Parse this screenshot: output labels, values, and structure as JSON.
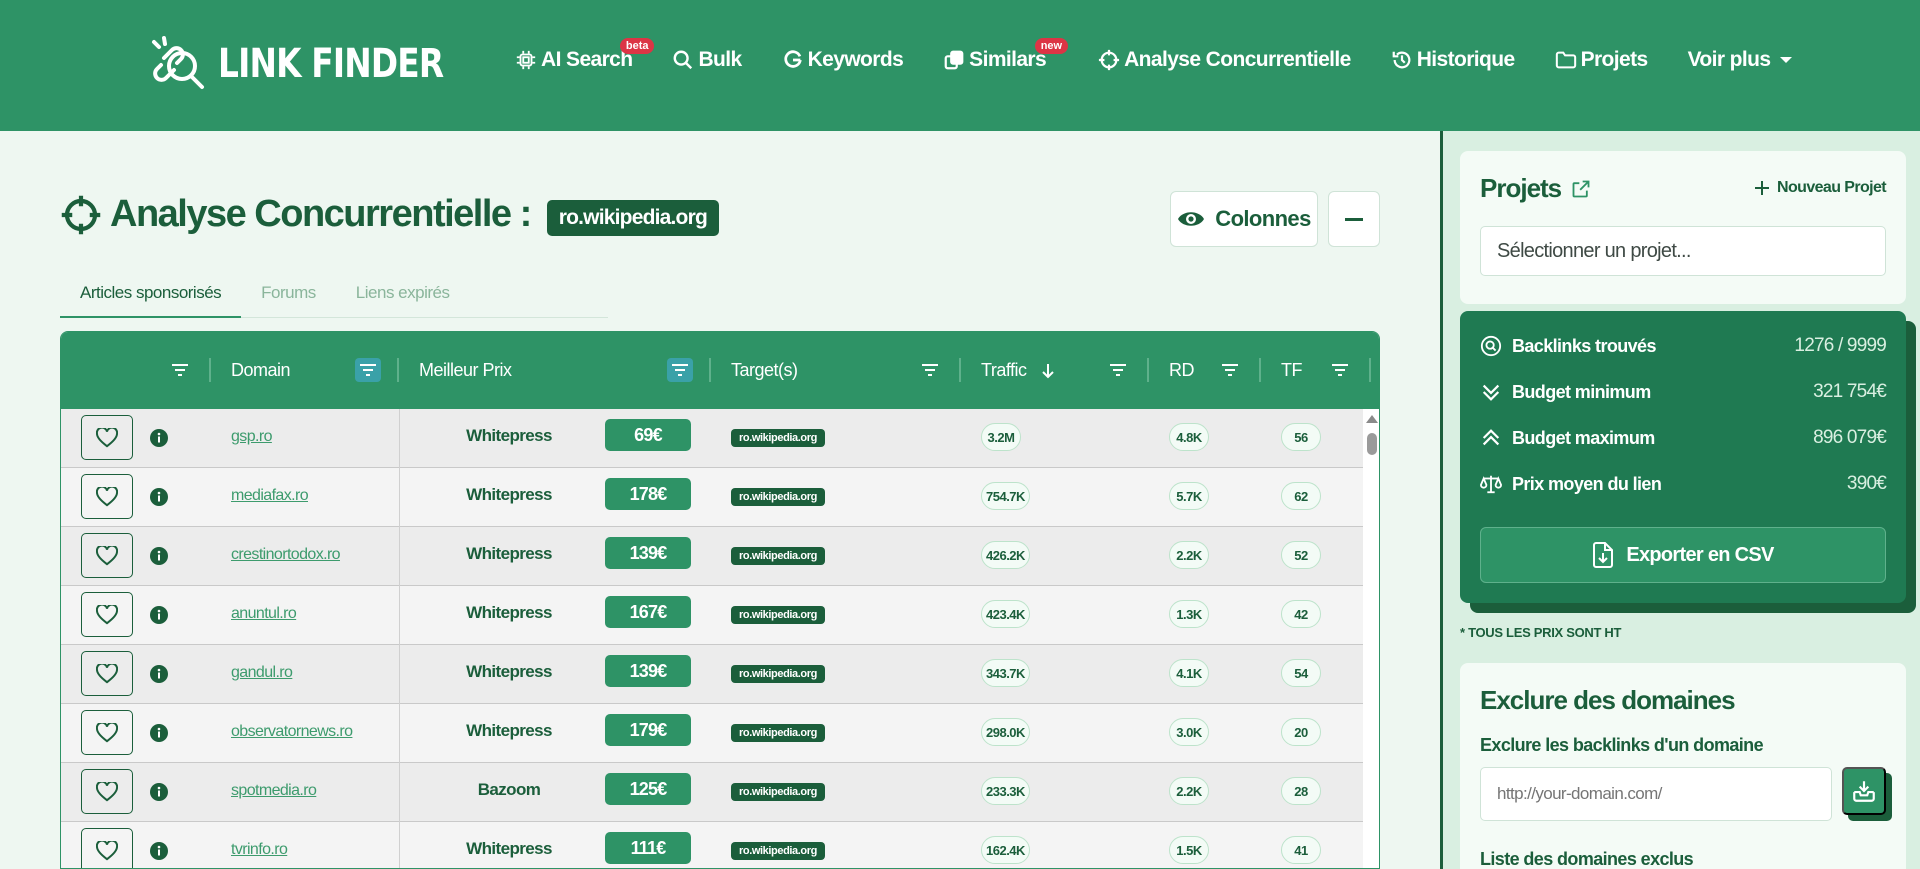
{
  "brand": {
    "name": "LINK FINDER"
  },
  "nav": {
    "items": [
      {
        "label": "AI Search",
        "badge": "beta",
        "icon": "chip-icon"
      },
      {
        "label": "Bulk",
        "badge": "",
        "icon": "search-icon"
      },
      {
        "label": "Keywords",
        "badge": "",
        "icon": "google-icon"
      },
      {
        "label": "Similars",
        "badge": "new",
        "icon": "copy-icon"
      },
      {
        "label": "Analyse Concurrentielle",
        "badge": "",
        "icon": "crosshair-icon"
      },
      {
        "label": "Historique",
        "badge": "",
        "icon": "history-icon"
      },
      {
        "label": "Projets",
        "badge": "",
        "icon": "folder-icon"
      },
      {
        "label": "Voir plus",
        "badge": "",
        "icon": "caret-down-icon"
      }
    ]
  },
  "page": {
    "title": "Analyse Concurrentielle :",
    "domain": "ro.wikipedia.org",
    "columns_button": "Colonnes"
  },
  "tabs": [
    {
      "label": "Articles sponsorisés",
      "active": true
    },
    {
      "label": "Forums",
      "active": false
    },
    {
      "label": "Liens expirés",
      "active": false
    }
  ],
  "table": {
    "headers": {
      "domain": "Domain",
      "price": "Meilleur Prix",
      "target": "Target(s)",
      "traffic": "Traffic",
      "rd": "RD",
      "tf": "TF"
    },
    "rows": [
      {
        "domain": "gsp.ro",
        "provider": "Whitepress",
        "price": "69€",
        "target": "ro.wikipedia.org",
        "traffic": "3.2M",
        "rd": "4.8K",
        "tf": "56"
      },
      {
        "domain": "mediafax.ro",
        "provider": "Whitepress",
        "price": "178€",
        "target": "ro.wikipedia.org",
        "traffic": "754.7K",
        "rd": "5.7K",
        "tf": "62"
      },
      {
        "domain": "crestinortodox.ro",
        "provider": "Whitepress",
        "price": "139€",
        "target": "ro.wikipedia.org",
        "traffic": "426.2K",
        "rd": "2.2K",
        "tf": "52"
      },
      {
        "domain": "anuntul.ro",
        "provider": "Whitepress",
        "price": "167€",
        "target": "ro.wikipedia.org",
        "traffic": "423.4K",
        "rd": "1.3K",
        "tf": "42"
      },
      {
        "domain": "gandul.ro",
        "provider": "Whitepress",
        "price": "139€",
        "target": "ro.wikipedia.org",
        "traffic": "343.7K",
        "rd": "4.1K",
        "tf": "54"
      },
      {
        "domain": "observatornews.ro",
        "provider": "Whitepress",
        "price": "179€",
        "target": "ro.wikipedia.org",
        "traffic": "298.0K",
        "rd": "3.0K",
        "tf": "20"
      },
      {
        "domain": "spotmedia.ro",
        "provider": "Bazoom",
        "price": "125€",
        "target": "ro.wikipedia.org",
        "traffic": "233.3K",
        "rd": "2.2K",
        "tf": "28"
      },
      {
        "domain": "tvrinfo.ro",
        "provider": "Whitepress",
        "price": "111€",
        "target": "ro.wikipedia.org",
        "traffic": "162.4K",
        "rd": "1.5K",
        "tf": "41"
      }
    ]
  },
  "sidebar": {
    "projects": {
      "title": "Projets",
      "new_project": "Nouveau Projet",
      "select_placeholder": "Sélectionner un projet..."
    },
    "stats": [
      {
        "label": "Backlinks trouvés",
        "value": "1276 / 9999",
        "icon": "search-circle-icon"
      },
      {
        "label": "Budget minimum",
        "value": "321 754€",
        "icon": "double-chevron-down-icon"
      },
      {
        "label": "Budget maximum",
        "value": "896 079€",
        "icon": "double-chevron-up-icon"
      },
      {
        "label": "Prix moyen du lien",
        "value": "390€",
        "icon": "scale-icon"
      }
    ],
    "export_button": "Exporter en CSV",
    "ht_note": "* TOUS LES PRIX SONT HT",
    "exclude": {
      "title": "Exclure des domaines",
      "subtitle": "Exclure les backlinks d'un domaine",
      "input_placeholder": "http://your-domain.com/",
      "list_title": "Liste des domaines exclus"
    }
  },
  "colors": {
    "primary": "#2e9366",
    "dark": "#1b5e3b",
    "badge": "#dc3545"
  }
}
